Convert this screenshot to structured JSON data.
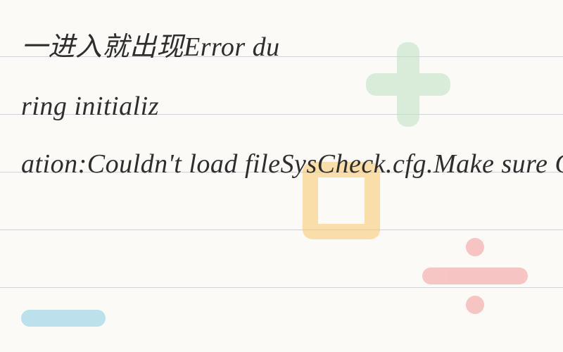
{
  "lines": {
    "l1": "一进入就出现Error du",
    "l2": "ring initializ",
    "l3": "ation:Couldn't load fileSysCheck.cfg.Make sure Cal",
    "l4": "",
    "l5": ""
  },
  "rule_positions": [
    80,
    162,
    244,
    326,
    408
  ]
}
